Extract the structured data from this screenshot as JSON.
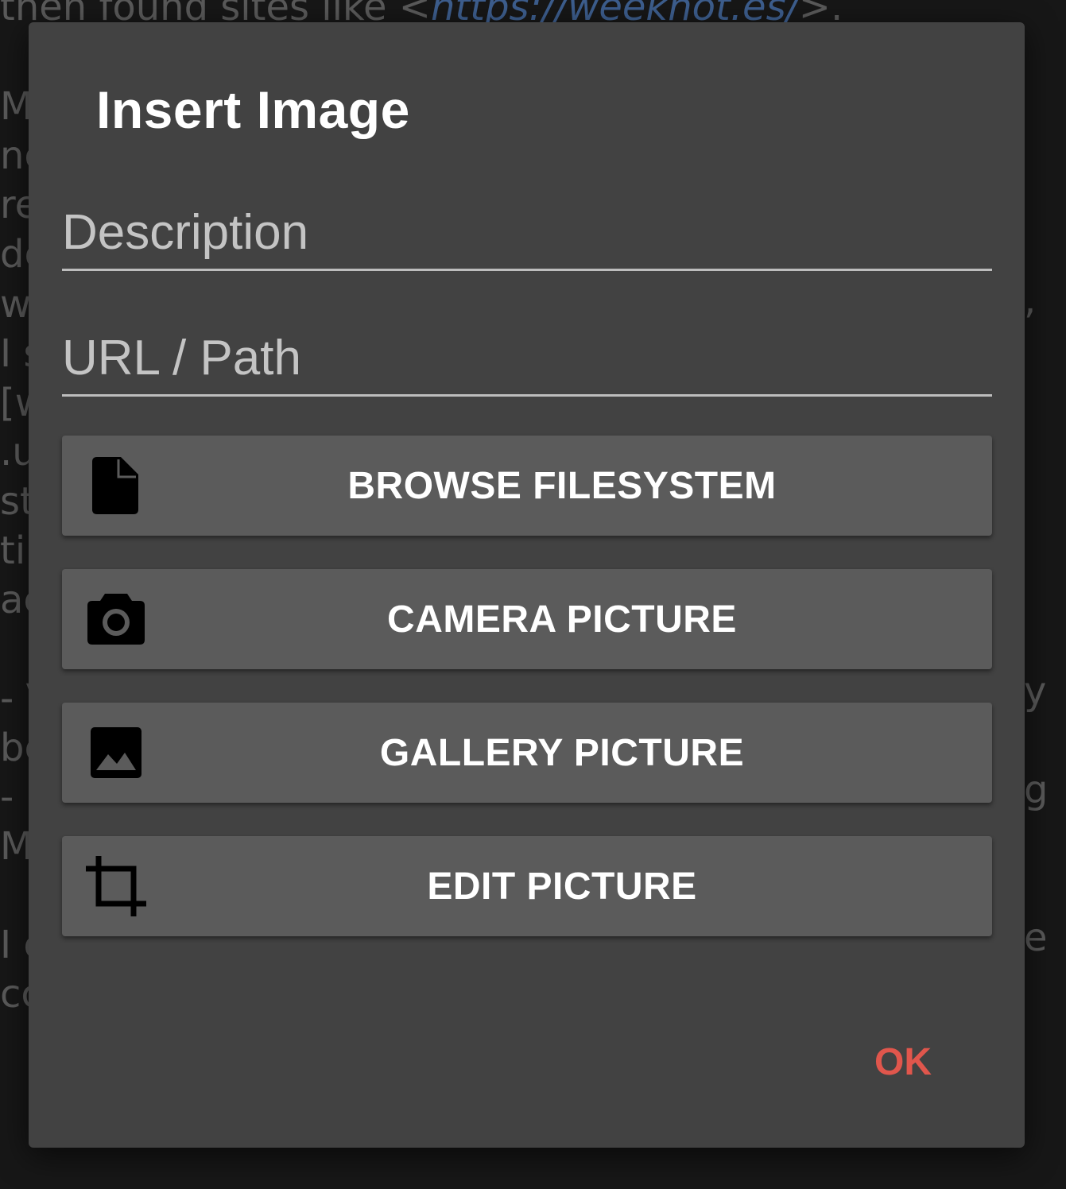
{
  "background": {
    "lines": [
      {
        "prefix": "then found sites like <",
        "link": "https://weeknot.es/",
        "suffix": ">."
      },
      {
        "text": "M"
      },
      {
        "text": "nc"
      },
      {
        "text": "re"
      },
      {
        "text": "dc"
      },
      {
        "text": "w"
      },
      {
        "text": "I s"
      },
      {
        "text": "[w"
      },
      {
        "text": ".u"
      },
      {
        "text": "st"
      },
      {
        "text": "ti"
      },
      {
        "text": "ac"
      },
      {
        "text": ""
      },
      {
        "text": "- V"
      },
      {
        "text": "be"
      },
      {
        "text": "- p"
      },
      {
        "text": "M"
      },
      {
        "text": ""
      },
      {
        "text": "I c"
      },
      {
        "text": "cc"
      }
    ],
    "right_fragments": [
      ",",
      "y",
      "g",
      "e"
    ]
  },
  "dialog": {
    "title": "Insert Image",
    "description_placeholder": "Description",
    "url_placeholder": "URL / Path",
    "buttons": [
      {
        "label": "BROWSE FILESYSTEM",
        "icon": "file-icon"
      },
      {
        "label": "CAMERA PICTURE",
        "icon": "camera-icon"
      },
      {
        "label": "GALLERY PICTURE",
        "icon": "image-icon"
      },
      {
        "label": "EDIT PICTURE",
        "icon": "crop-icon"
      }
    ],
    "ok_label": "OK",
    "accent_color": "#e0564c"
  }
}
